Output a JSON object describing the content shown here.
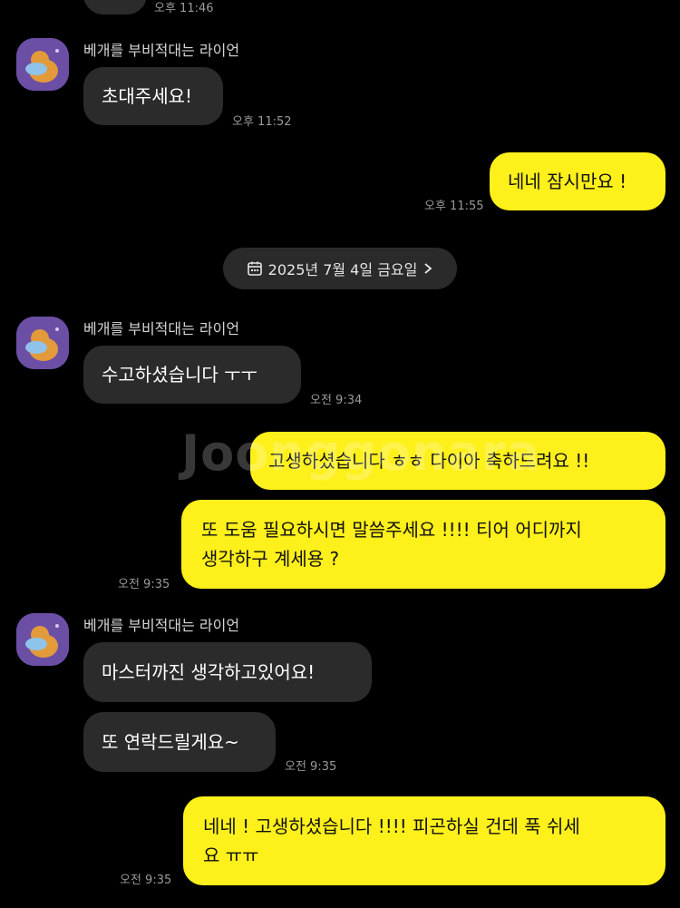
{
  "sender_name": "베개를 부비적대는 라이언",
  "top_partial": {
    "time": "오후 11:46"
  },
  "messages": {
    "m1": {
      "text": "초대주세요!",
      "time": "오후 11:52"
    },
    "m2": {
      "text": "네네 잠시만요 !",
      "time": "오후 11:55"
    },
    "m3": {
      "text": "수고하셨습니다 ㅜㅜ",
      "time": "오전 9:34"
    },
    "m4": {
      "text": "고생하셨습니다 ㅎㅎ 다이아 축하드려요 !!"
    },
    "m5": {
      "line1": "또 도움 필요하시면 말씀주세요 !!!! 티어 어디까지",
      "line2": "생각하구 계세용 ?",
      "time": "오전 9:35"
    },
    "m6": {
      "text": "마스터까진 생각하고있어요!"
    },
    "m7": {
      "text": "또 연락드릴게요~",
      "time": "오전 9:35"
    },
    "m8": {
      "line1": "네네 ! 고생하셨습니다 !!!! 피곤하실 건데 푹 쉬세",
      "line2": "요 ㅠㅠ",
      "time": "오전 9:35"
    }
  },
  "date_divider": {
    "label": "2025년 7월 4일 금요일"
  },
  "watermark": "Joonggonara",
  "colors": {
    "incoming": "#2b2b2b",
    "outgoing": "#fef01b",
    "background": "#000000"
  },
  "icons": [
    "calendar-icon",
    "chevron-right-icon",
    "profile-avatar-lion"
  ]
}
